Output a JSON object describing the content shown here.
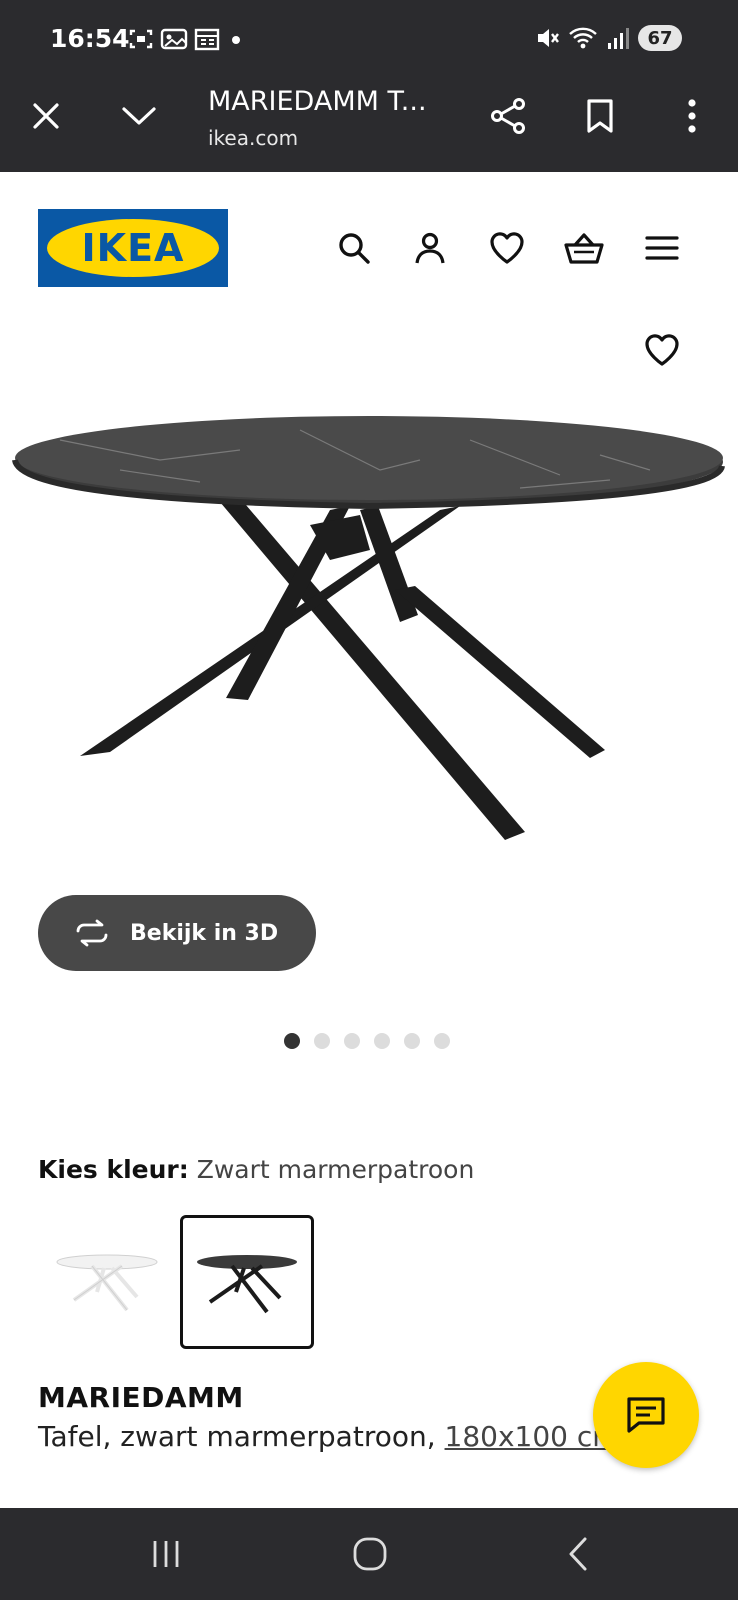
{
  "status_bar": {
    "time": "16:54",
    "battery": "67",
    "icons_left": [
      "screenshot-icon",
      "gallery-icon",
      "calendar-icon",
      "dot-icon"
    ],
    "icons_right": [
      "mute-icon",
      "wifi-icon",
      "signal-icon"
    ]
  },
  "browser": {
    "page_title": "MARIEDAMM T...",
    "host": "ikea.com"
  },
  "header": {
    "logo_text": "IKEA",
    "icons": [
      "search-icon",
      "account-icon",
      "wishlist-icon",
      "basket-icon",
      "menu-icon"
    ]
  },
  "product": {
    "view_3d_label": "Bekijk in 3D",
    "image_count": 6,
    "active_image": 0,
    "color_label": "Kies kleur:",
    "color_value": "Zwart marmerpatroon",
    "swatches": [
      "white",
      "black"
    ],
    "selected_swatch": 1,
    "name": "MARIEDAMM",
    "description": "Tafel, zwart marmerpatroon, ",
    "size": "180x100 cm"
  },
  "colors": {
    "chrome_bg": "#2b2b2e",
    "ikea_blue": "#0a58a5",
    "ikea_yellow": "#ffd600",
    "button_dark": "#484848"
  }
}
